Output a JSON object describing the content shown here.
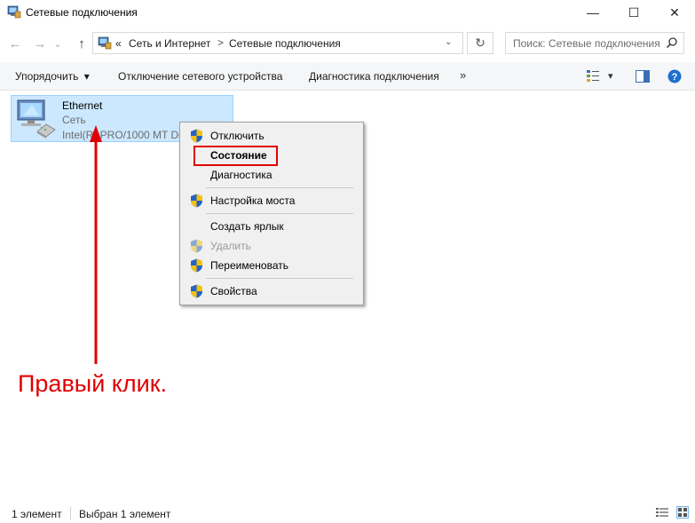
{
  "window": {
    "title": "Сетевые подключения",
    "minimize_glyph": "—",
    "maximize_glyph": "☐",
    "close_glyph": "✕"
  },
  "nav": {
    "back_glyph": "←",
    "forward_glyph": "→",
    "recent_glyph": "⌄",
    "up_glyph": "↑",
    "overflow_glyph": "«",
    "breadcrumb": [
      "Сеть и Интернет",
      "Сетевые подключения"
    ],
    "separator_glyph": ">",
    "dropdown_glyph": "⌄",
    "refresh_glyph": "↻"
  },
  "search": {
    "placeholder": "Поиск: Сетевые подключения"
  },
  "toolbar": {
    "organize_label": "Упорядочить",
    "organize_arrow": "▾",
    "disable_label": "Отключение сетевого устройства",
    "diagnose_label": "Диагностика подключения",
    "more_glyph": "»",
    "view_arrow": "▾"
  },
  "connection": {
    "name": "Ethernet",
    "network": "Сеть",
    "adapter": "Intel(R) PRO/1000 MT Desktop Adapter"
  },
  "context_menu": {
    "items": [
      {
        "label": "Отключить",
        "shield": true,
        "enabled": true
      },
      {
        "label": "Состояние",
        "shield": false,
        "enabled": true,
        "bold": true
      },
      {
        "label": "Диагностика",
        "shield": false,
        "enabled": true
      },
      {
        "label": "Настройка моста",
        "shield": true,
        "enabled": true
      },
      {
        "label": "Создать ярлык",
        "shield": false,
        "enabled": true
      },
      {
        "label": "Удалить",
        "shield": true,
        "enabled": false
      },
      {
        "label": "Переименовать",
        "shield": true,
        "enabled": true
      },
      {
        "label": "Свойства",
        "shield": true,
        "enabled": true
      }
    ]
  },
  "annotation": {
    "text": "Правый клик.",
    "color": "#e00000"
  },
  "status": {
    "count": "1 элемент",
    "selected": "Выбран 1 элемент"
  },
  "colors": {
    "selection_bg": "#cce8ff",
    "selection_border": "#99d1ff",
    "menu_bg": "#f0f0f0",
    "accent_red": "#e00000"
  },
  "icons": [
    "network-connections-icon",
    "ethernet-adapter-icon",
    "uac-shield-icon",
    "search-icon",
    "details-view-icon",
    "large-icons-view-icon",
    "preview-pane-icon",
    "help-icon"
  ]
}
